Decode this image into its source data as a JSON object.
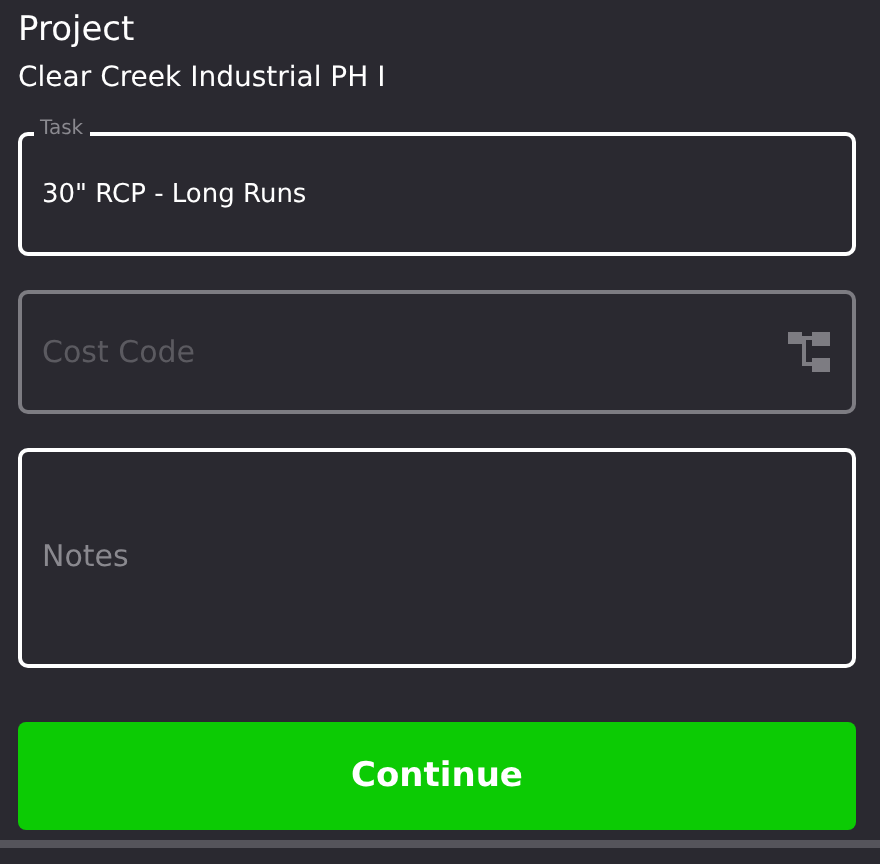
{
  "header": {
    "title": "Project",
    "subtitle": "Clear Creek Industrial PH I"
  },
  "fields": [
    {
      "kind": "text",
      "label": "Task",
      "value": "30\" RCP - Long Runs",
      "disabled": false
    },
    {
      "kind": "picker",
      "placeholder": "Cost Code",
      "disabled": true
    },
    {
      "kind": "textarea",
      "placeholder": "Notes",
      "disabled": false
    }
  ],
  "button": {
    "label": "Continue"
  }
}
